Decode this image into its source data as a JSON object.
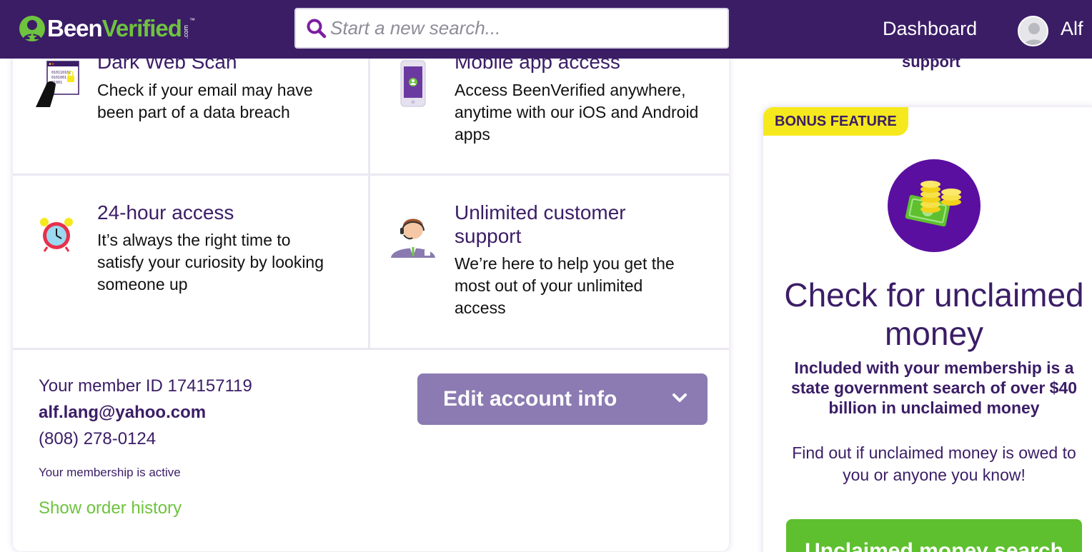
{
  "header": {
    "logo_text_white": "Been",
    "logo_text_green": "Verified",
    "logo_tld": ".com",
    "logo_tm": "™",
    "search_placeholder": "Start a new search...",
    "nav_dashboard": "Dashboard",
    "user_name": "Alf"
  },
  "features": [
    {
      "title": "Dark Web Scan",
      "description": "Check if your email may have been part of a data breach",
      "icon": "dark-web-scan-icon",
      "icon_data": "010110101 0101001 01001"
    },
    {
      "title": "Mobile app access",
      "description": "Access BeenVerified anywhere, anytime with our iOS and Android apps",
      "icon": "mobile-phone-icon"
    },
    {
      "title": "24-hour access",
      "description": "It’s always the right time to satisfy your curiosity by looking someone up",
      "icon": "alarm-clock-icon"
    },
    {
      "title": "Unlimited customer support",
      "description": "We’re here to help you get the most out of your unlimited access",
      "icon": "support-agent-icon"
    }
  ],
  "member": {
    "id_label": "Your member ID 174157119",
    "email": "alf.lang@yahoo.com",
    "phone": "(808) 278-0124",
    "status": "Your membership is active",
    "order_history_link": "Show order history",
    "edit_button": "Edit account info"
  },
  "right_column": {
    "support_snippet": "support",
    "bonus": {
      "badge": "BONUS FEATURE",
      "title": "Check for unclaimed money",
      "bold_text": "Included with your membership is a state government search of over $40 billion in unclaimed money",
      "description": "Find out if unclaimed money is owed to you or anyone you know!",
      "button": "Unclaimed money search"
    }
  },
  "colors": {
    "brand_purple": "#3b1d66",
    "brand_green": "#6ec33f",
    "button_purple": "#8b7bb2",
    "badge_yellow": "#f5e91e",
    "coin_circle": "#5b0fa0"
  }
}
